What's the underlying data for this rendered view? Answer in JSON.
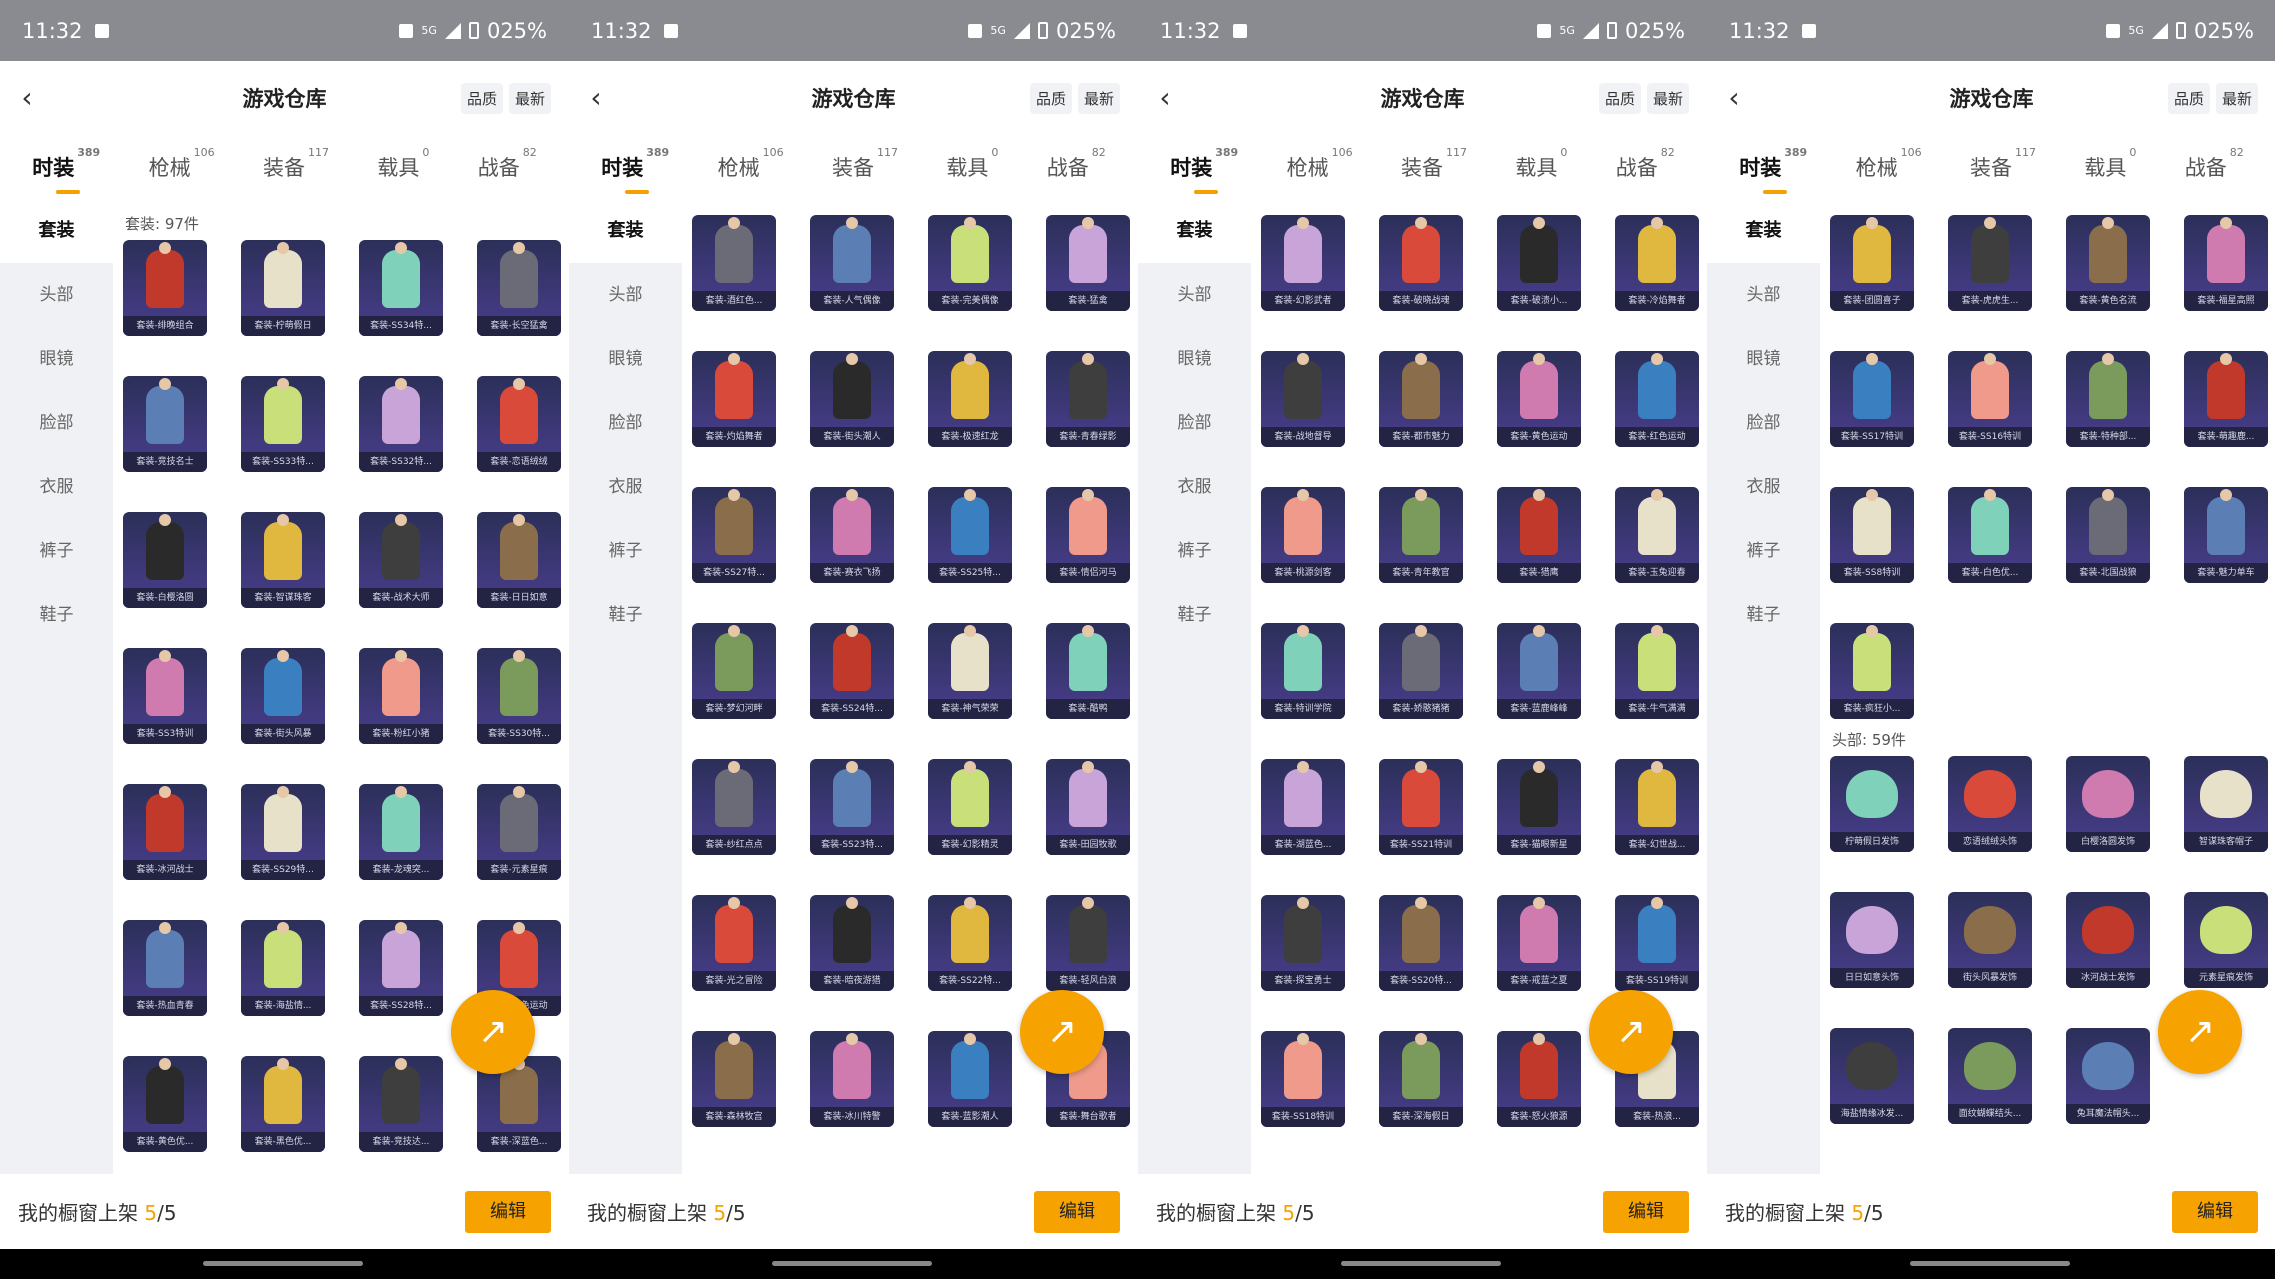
{
  "status": {
    "time": "11:32",
    "battery": "025%",
    "network": "5G"
  },
  "header": {
    "title": "游戏仓库",
    "back_icon": "chevron-left-icon",
    "sort_quality": "品质",
    "sort_latest": "最新"
  },
  "tabs": [
    {
      "label": "时装",
      "count": "389",
      "active": true
    },
    {
      "label": "枪械",
      "count": "106",
      "active": false
    },
    {
      "label": "装备",
      "count": "117",
      "active": false
    },
    {
      "label": "载具",
      "count": "0",
      "active": false
    },
    {
      "label": "战备",
      "count": "82",
      "active": false
    }
  ],
  "sidebar": [
    "套装",
    "头部",
    "眼镜",
    "脸部",
    "衣服",
    "裤子",
    "鞋子"
  ],
  "footer": {
    "label": "我的橱窗上架",
    "current": "5",
    "total": "/5",
    "edit_button": "编辑"
  },
  "fab_icon": "share-icon",
  "panels": [
    {
      "section_label": "套装: 97件",
      "items": [
        "套装-绯晚组合",
        "套装-柠萌假日",
        "套装-SS34特...",
        "套装-长空猛禽",
        "套装-竞技名士",
        "套装-SS33特...",
        "套装-SS32特...",
        "套装-恋语绒绒",
        "套装-白樱洛圆",
        "套装-智谋珠客",
        "套装-战术大师",
        "套装-日日如意",
        "套装-SS3特训",
        "套装-街头风暴",
        "套装-粉红小猪",
        "套装-SS30特...",
        "套装-冰河战士",
        "套装-SS29特...",
        "套装-龙魂突...",
        "套装-元素星痕",
        "套装-热血青春",
        "套装-海盐情...",
        "套装-SS28特...",
        "套装-蓝色运动",
        "套装-黄色优...",
        "套装-黑色优...",
        "套装-竞技达...",
        "套装-深蓝色..."
      ]
    },
    {
      "section_label": "",
      "items": [
        "套装-酒红色...",
        "套装-人气偶像",
        "套装-完美偶像",
        "套装-猛禽",
        "套装-灼焰舞者",
        "套装-街头潮人",
        "套装-极速红龙",
        "套装-青春绿影",
        "套装-SS27特...",
        "套装-赛衣飞扬",
        "套装-SS25特...",
        "套装-情侣河马",
        "套装-梦幻河畔",
        "套装-SS24特...",
        "套装-神气荣荣",
        "套装-酷鸭",
        "套装-纱红点点",
        "套装-SS23特...",
        "套装-幻影精灵",
        "套装-田园牧歌",
        "套装-光之冒险",
        "套装-暗夜游猎",
        "套装-SS22特...",
        "套装-轻风白浪",
        "套装-森林牧宫",
        "套装-冰川特警",
        "套装-蓝影潮人",
        "套装-舞台歌者"
      ]
    },
    {
      "section_label": "",
      "items": [
        "套装-幻影武者",
        "套装-破晓战魂",
        "套装-破溃小...",
        "套装-冷焰舞者",
        "套装-战地督导",
        "套装-都市魅力",
        "套装-黄色运动",
        "套装-红色运动",
        "套装-桃源剑客",
        "套装-青年教官",
        "套装-猎鹰",
        "套装-玉兔迎春",
        "套装-特训学院",
        "套装-娇憨猪猪",
        "套装-蓝鹿峰峰",
        "套装-牛气满满",
        "套装-湖蓝色...",
        "套装-SS21特训",
        "套装-猫眼新星",
        "套装-幻世战...",
        "套装-探宝勇士",
        "套装-SS20特...",
        "套装-戒蓝之夏",
        "套装-SS19特训",
        "套装-SS18特训",
        "套装-深海假日",
        "套装-怒火狼源",
        "套装-热浪..."
      ]
    },
    {
      "section_label": "",
      "head_label": "头部: 59件",
      "items": [
        "套装-团圆喜子",
        "套装-虎虎生...",
        "套装-黄色名流",
        "套装-福星高照",
        "套装-SS17特训",
        "套装-SS16特训",
        "套装-特种部...",
        "套装-萌趣鹿...",
        "套装-SS8特训",
        "套装-白色优...",
        "套装-北国战狼",
        "套装-魅力单车",
        "套装-疯狂小..."
      ],
      "head_items": [
        "柠萌假日发饰",
        "恋语绒绒头饰",
        "白樱洛圆发饰",
        "智谋珠客帽子",
        "日日如意头饰",
        "街头风暴发饰",
        "冰河战士发饰",
        "元素星痕发饰",
        "海盐情缘冰发...",
        "面纹蝴蝶结头...",
        "兔耳魔法帽头..."
      ]
    }
  ]
}
